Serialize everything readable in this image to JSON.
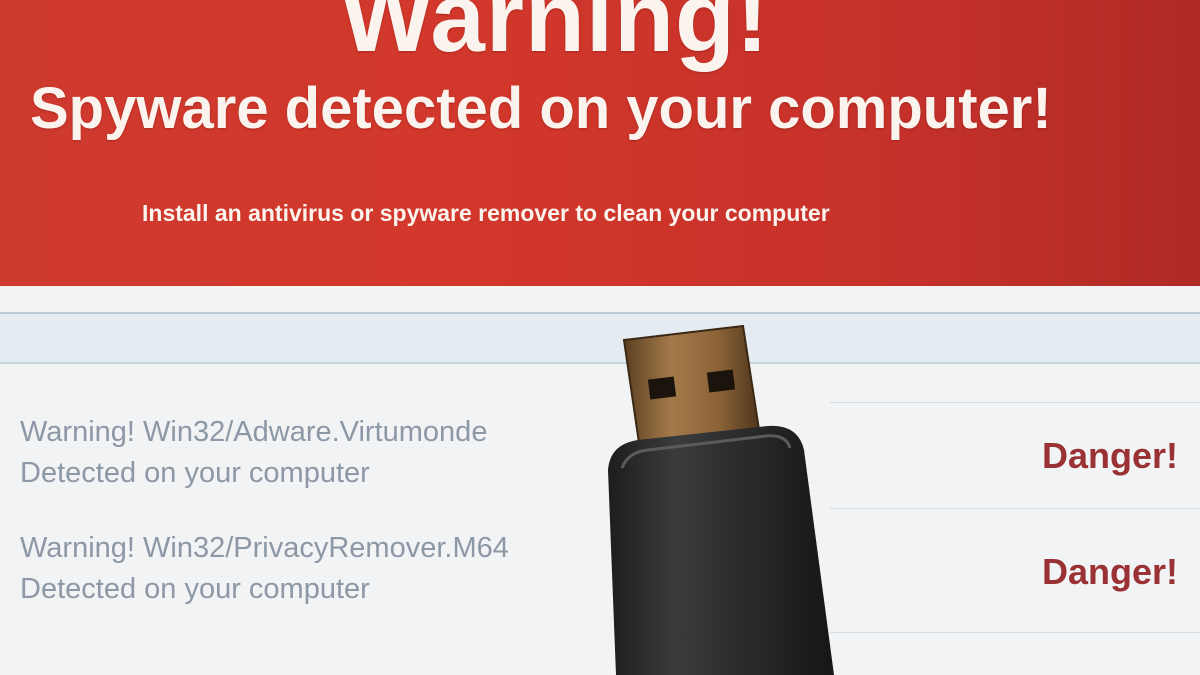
{
  "banner": {
    "title": "Warning!",
    "subtitle": "Spyware detected on your computer!",
    "instruction": "Install an antivirus or spyware remover to clean your computer",
    "color": "#cf3a2e"
  },
  "threats": [
    {
      "name": "Warning! Win32/Adware.Virtumonde",
      "detail": "Detected on your computer",
      "status": "Danger!"
    },
    {
      "name": "Warning! Win32/PrivacyRemover.M64",
      "detail": "Detected on your computer",
      "status": "Danger!"
    }
  ],
  "colors": {
    "danger": "#9a3134",
    "threat_text": "#8d98a6",
    "panel_band": "#e4ebf1"
  },
  "overlay": {
    "object": "usb-drive"
  }
}
